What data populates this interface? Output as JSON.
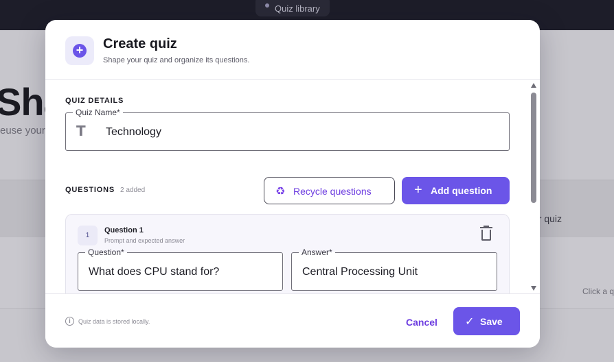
{
  "background": {
    "tab_label": "Quiz library",
    "hero_title": "Sha",
    "hero_subtitle": "euse your",
    "side_text": "er quiz",
    "hint_text": "Click a q"
  },
  "modal": {
    "title": "Create quiz",
    "subtitle": "Shape your quiz and organize its questions.",
    "header_icon": "plus-circle-icon",
    "details_label": "QUIZ DETAILS",
    "quiz_name": {
      "label": "Quiz Name*",
      "value": "Technology",
      "icon": "text-t-icon"
    },
    "questions_label": "QUESTIONS",
    "questions_count": "2 added",
    "recycle_button": {
      "label": "Recycle questions",
      "icon": "recycle-icon"
    },
    "add_button": {
      "label": "Add question",
      "icon": "plus-icon"
    },
    "questions": [
      {
        "number": "1",
        "title": "Question 1",
        "subtitle": "Prompt and expected answer",
        "question_label": "Question*",
        "question_value": "What does CPU stand for?",
        "answer_label": "Answer*",
        "answer_value": "Central Processing Unit"
      }
    ],
    "footer": {
      "info_text": "Quiz data is stored locally.",
      "cancel_label": "Cancel",
      "save_label": "Save"
    }
  },
  "colors": {
    "accent": "#6b55e8",
    "accent_text": "#6d3de0",
    "topbar": "#1d1d29"
  }
}
